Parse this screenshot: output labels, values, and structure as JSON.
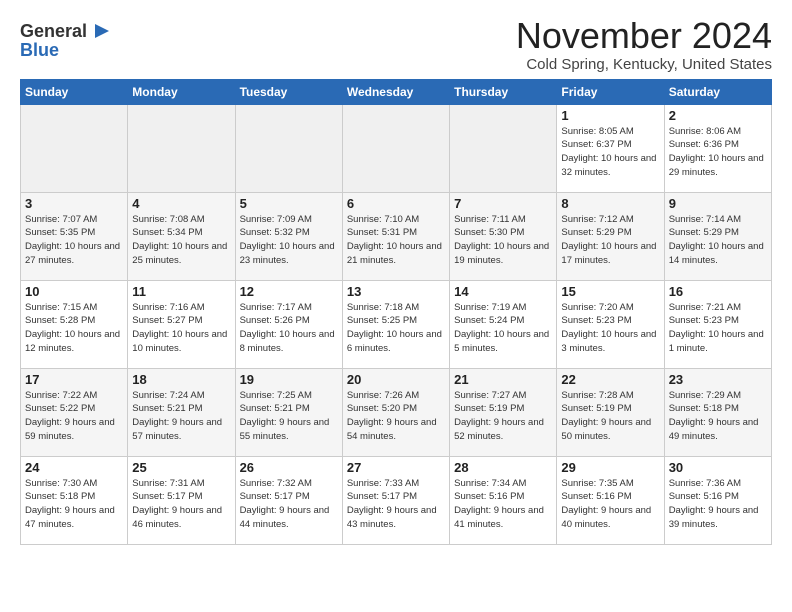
{
  "logo": {
    "general": "General",
    "blue": "Blue",
    "icon": "▶"
  },
  "title": "November 2024",
  "location": "Cold Spring, Kentucky, United States",
  "days_of_week": [
    "Sunday",
    "Monday",
    "Tuesday",
    "Wednesday",
    "Thursday",
    "Friday",
    "Saturday"
  ],
  "weeks": [
    {
      "days": [
        {
          "num": "",
          "info": ""
        },
        {
          "num": "",
          "info": ""
        },
        {
          "num": "",
          "info": ""
        },
        {
          "num": "",
          "info": ""
        },
        {
          "num": "",
          "info": ""
        },
        {
          "num": "1",
          "info": "Sunrise: 8:05 AM\nSunset: 6:37 PM\nDaylight: 10 hours and 32 minutes."
        },
        {
          "num": "2",
          "info": "Sunrise: 8:06 AM\nSunset: 6:36 PM\nDaylight: 10 hours and 29 minutes."
        }
      ]
    },
    {
      "days": [
        {
          "num": "3",
          "info": "Sunrise: 7:07 AM\nSunset: 5:35 PM\nDaylight: 10 hours and 27 minutes."
        },
        {
          "num": "4",
          "info": "Sunrise: 7:08 AM\nSunset: 5:34 PM\nDaylight: 10 hours and 25 minutes."
        },
        {
          "num": "5",
          "info": "Sunrise: 7:09 AM\nSunset: 5:32 PM\nDaylight: 10 hours and 23 minutes."
        },
        {
          "num": "6",
          "info": "Sunrise: 7:10 AM\nSunset: 5:31 PM\nDaylight: 10 hours and 21 minutes."
        },
        {
          "num": "7",
          "info": "Sunrise: 7:11 AM\nSunset: 5:30 PM\nDaylight: 10 hours and 19 minutes."
        },
        {
          "num": "8",
          "info": "Sunrise: 7:12 AM\nSunset: 5:29 PM\nDaylight: 10 hours and 17 minutes."
        },
        {
          "num": "9",
          "info": "Sunrise: 7:14 AM\nSunset: 5:29 PM\nDaylight: 10 hours and 14 minutes."
        }
      ]
    },
    {
      "days": [
        {
          "num": "10",
          "info": "Sunrise: 7:15 AM\nSunset: 5:28 PM\nDaylight: 10 hours and 12 minutes."
        },
        {
          "num": "11",
          "info": "Sunrise: 7:16 AM\nSunset: 5:27 PM\nDaylight: 10 hours and 10 minutes."
        },
        {
          "num": "12",
          "info": "Sunrise: 7:17 AM\nSunset: 5:26 PM\nDaylight: 10 hours and 8 minutes."
        },
        {
          "num": "13",
          "info": "Sunrise: 7:18 AM\nSunset: 5:25 PM\nDaylight: 10 hours and 6 minutes."
        },
        {
          "num": "14",
          "info": "Sunrise: 7:19 AM\nSunset: 5:24 PM\nDaylight: 10 hours and 5 minutes."
        },
        {
          "num": "15",
          "info": "Sunrise: 7:20 AM\nSunset: 5:23 PM\nDaylight: 10 hours and 3 minutes."
        },
        {
          "num": "16",
          "info": "Sunrise: 7:21 AM\nSunset: 5:23 PM\nDaylight: 10 hours and 1 minute."
        }
      ]
    },
    {
      "days": [
        {
          "num": "17",
          "info": "Sunrise: 7:22 AM\nSunset: 5:22 PM\nDaylight: 9 hours and 59 minutes."
        },
        {
          "num": "18",
          "info": "Sunrise: 7:24 AM\nSunset: 5:21 PM\nDaylight: 9 hours and 57 minutes."
        },
        {
          "num": "19",
          "info": "Sunrise: 7:25 AM\nSunset: 5:21 PM\nDaylight: 9 hours and 55 minutes."
        },
        {
          "num": "20",
          "info": "Sunrise: 7:26 AM\nSunset: 5:20 PM\nDaylight: 9 hours and 54 minutes."
        },
        {
          "num": "21",
          "info": "Sunrise: 7:27 AM\nSunset: 5:19 PM\nDaylight: 9 hours and 52 minutes."
        },
        {
          "num": "22",
          "info": "Sunrise: 7:28 AM\nSunset: 5:19 PM\nDaylight: 9 hours and 50 minutes."
        },
        {
          "num": "23",
          "info": "Sunrise: 7:29 AM\nSunset: 5:18 PM\nDaylight: 9 hours and 49 minutes."
        }
      ]
    },
    {
      "days": [
        {
          "num": "24",
          "info": "Sunrise: 7:30 AM\nSunset: 5:18 PM\nDaylight: 9 hours and 47 minutes."
        },
        {
          "num": "25",
          "info": "Sunrise: 7:31 AM\nSunset: 5:17 PM\nDaylight: 9 hours and 46 minutes."
        },
        {
          "num": "26",
          "info": "Sunrise: 7:32 AM\nSunset: 5:17 PM\nDaylight: 9 hours and 44 minutes."
        },
        {
          "num": "27",
          "info": "Sunrise: 7:33 AM\nSunset: 5:17 PM\nDaylight: 9 hours and 43 minutes."
        },
        {
          "num": "28",
          "info": "Sunrise: 7:34 AM\nSunset: 5:16 PM\nDaylight: 9 hours and 41 minutes."
        },
        {
          "num": "29",
          "info": "Sunrise: 7:35 AM\nSunset: 5:16 PM\nDaylight: 9 hours and 40 minutes."
        },
        {
          "num": "30",
          "info": "Sunrise: 7:36 AM\nSunset: 5:16 PM\nDaylight: 9 hours and 39 minutes."
        }
      ]
    }
  ]
}
